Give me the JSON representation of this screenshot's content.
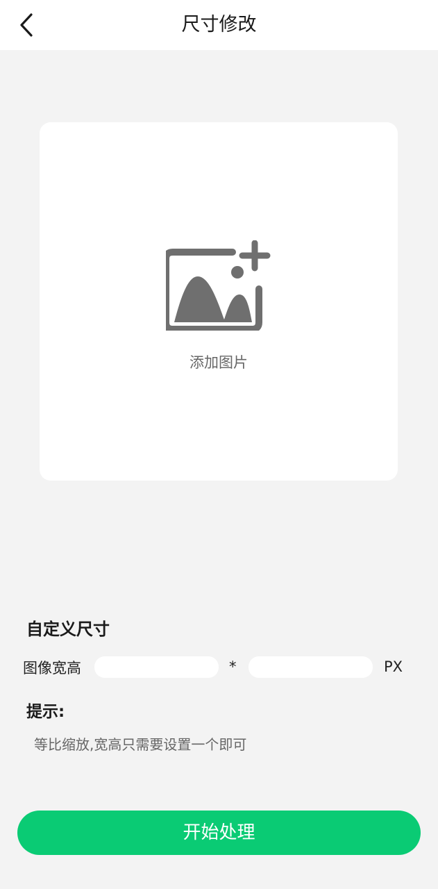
{
  "header": {
    "title": "尺寸修改",
    "back_icon": "chevron-left-icon"
  },
  "upload": {
    "icon": "add-image-icon",
    "label": "添加图片"
  },
  "custom_size": {
    "section_title": "自定义尺寸",
    "row_label": "图像宽高",
    "width_value": "",
    "height_value": "",
    "separator": "*",
    "unit": "PX"
  },
  "tip": {
    "title": "提示:",
    "text": "等比缩放,宽高只需要设置一个即可"
  },
  "action": {
    "start_label": "开始处理"
  },
  "colors": {
    "accent": "#0acb74",
    "background": "#f3f3f3",
    "icon_gray": "#6f6f6f"
  }
}
